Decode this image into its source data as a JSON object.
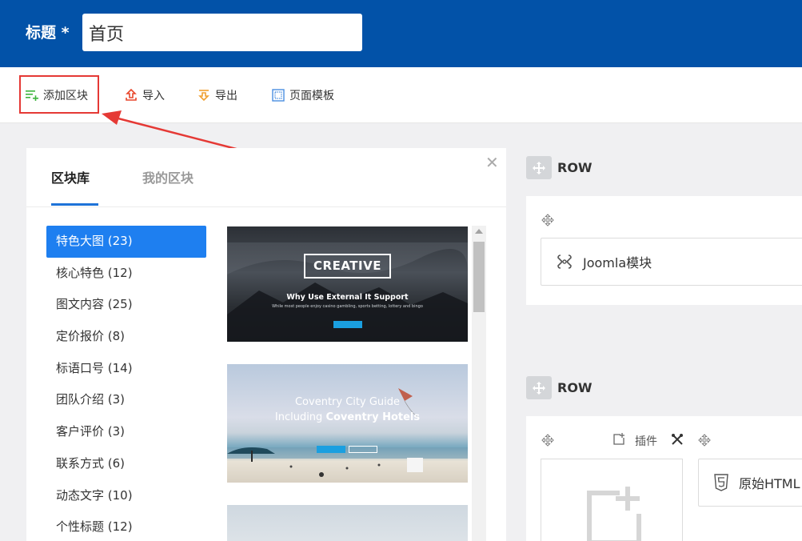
{
  "header": {
    "title_label": "标题 *",
    "title_value": "首页"
  },
  "toolbar": {
    "add_block": "添加区块",
    "import": "导入",
    "export": "导出",
    "page_template": "页面模板"
  },
  "panel": {
    "tabs": [
      {
        "label": "区块库",
        "active": true
      },
      {
        "label": "我的区块",
        "active": false
      }
    ],
    "close_symbol": "✕",
    "categories": [
      {
        "label": "特色大图 (23)",
        "active": true
      },
      {
        "label": "核心特色 (12)",
        "active": false
      },
      {
        "label": "图文内容 (25)",
        "active": false
      },
      {
        "label": "定价报价 (8)",
        "active": false
      },
      {
        "label": "标语口号 (14)",
        "active": false
      },
      {
        "label": "团队介绍 (3)",
        "active": false
      },
      {
        "label": "客户评价 (3)",
        "active": false
      },
      {
        "label": "联系方式 (6)",
        "active": false
      },
      {
        "label": "动态文字 (10)",
        "active": false
      },
      {
        "label": "个性标题 (12)",
        "active": false
      }
    ],
    "thumbnails": [
      {
        "title": "CREATIVE",
        "subtitle": "Why Use External It Support",
        "small_text": "While most people enjoy casino gambling, sports betting, lottery and bingo"
      },
      {
        "line1": "Coventry City Guide",
        "line2_prefix": "Including ",
        "line2_bold": "Coventry Hotels"
      }
    ]
  },
  "layout": {
    "rows": [
      {
        "label": "ROW",
        "modules": [
          {
            "label": "Joomla模块",
            "icon": "joomla-icon"
          }
        ]
      },
      {
        "label": "ROW",
        "addon_label": "插件",
        "modules": [
          {
            "label": "原始HTML",
            "icon": "html5-icon"
          }
        ]
      }
    ]
  },
  "colors": {
    "header_bg": "#0252a8",
    "accent_blue": "#1e7ff0",
    "highlight_red": "#e53935"
  }
}
